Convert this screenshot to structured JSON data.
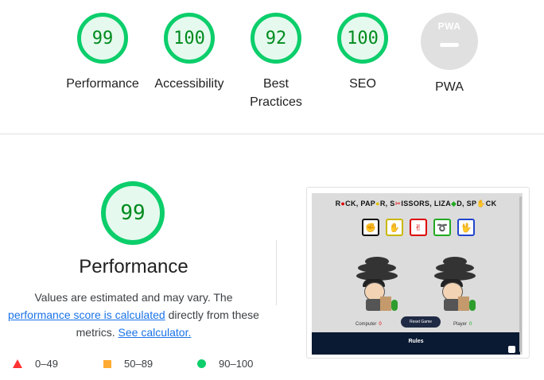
{
  "summary_gauges": [
    {
      "score": "99",
      "label": "Performance"
    },
    {
      "score": "100",
      "label": "Accessibility"
    },
    {
      "score": "92",
      "label": "Best Practices"
    },
    {
      "score": "100",
      "label": "SEO"
    }
  ],
  "pwa": {
    "badge": "PWA",
    "label": "PWA"
  },
  "performance": {
    "score": "99",
    "title": "Performance",
    "desc_part1": "Values are estimated and may vary. The",
    "desc_link1": "performance score is calculated",
    "desc_part2": "directly from these metrics.",
    "desc_link2": "See calculator."
  },
  "legend": {
    "fail": "0–49",
    "average": "50–89",
    "pass": "90–100"
  },
  "screenshot": {
    "title_parts": [
      "R",
      "CK, PAP",
      "R, S",
      "ISSORS, LIZA",
      "D, SP",
      "CK"
    ],
    "choices": [
      "rock-icon",
      "paper-icon",
      "scissors-icon",
      "lizard-icon",
      "spock-icon"
    ],
    "computer_label": "Computer",
    "computer_score": "0",
    "player_label": "Player",
    "player_score": "0",
    "reset_label": "Reset Game",
    "rules_label": "Rules"
  },
  "colors": {
    "pass": "#0cce6b",
    "pass_text": "#008b1e",
    "average": "#ffaa33",
    "fail": "#ff3333",
    "link": "#1a73e8"
  }
}
